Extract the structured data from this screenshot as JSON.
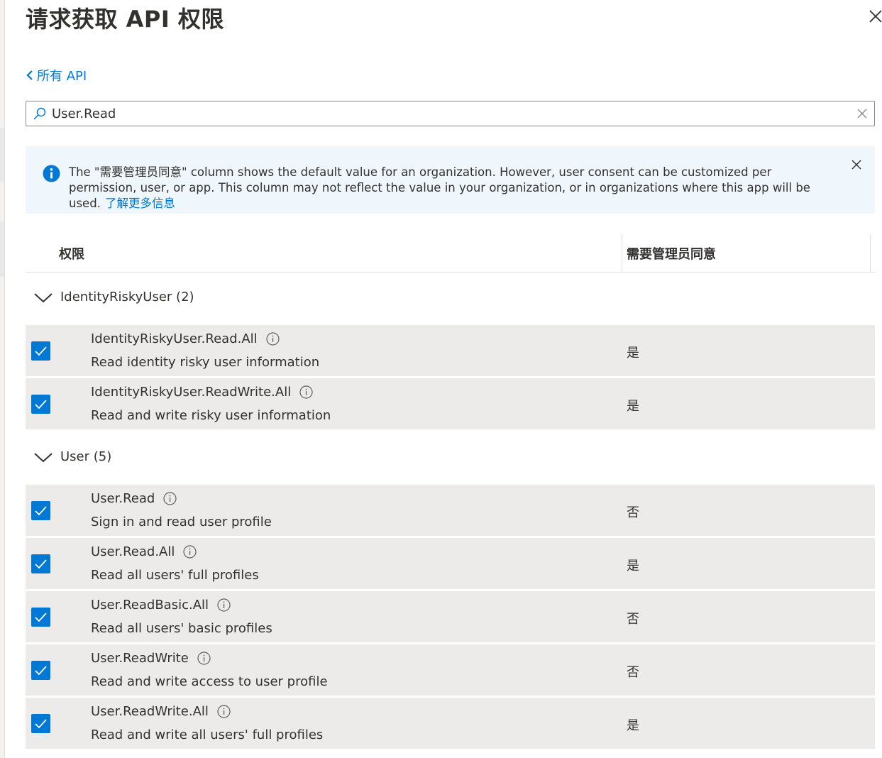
{
  "title": "请求获取 API 权限",
  "back_link": "所有 API",
  "search": {
    "value": "User.Read"
  },
  "info_banner": {
    "message": "The \"需要管理员同意\" column shows the default value for an organization. However, user consent can be customized per permission, user, or app. This column may not reflect the value in your organization, or in organizations where this app will be used.",
    "link": "了解更多信息"
  },
  "table": {
    "col_permission": "权限",
    "col_admin_consent": "需要管理员同意"
  },
  "groups": [
    {
      "label": "IdentityRiskyUser (2)",
      "rows": [
        {
          "name": "IdentityRiskyUser.Read.All",
          "desc": "Read identity risky user information",
          "consent": "是",
          "checked": true
        },
        {
          "name": "IdentityRiskyUser.ReadWrite.All",
          "desc": "Read and write risky user information",
          "consent": "是",
          "checked": true
        }
      ]
    },
    {
      "label": "User (5)",
      "rows": [
        {
          "name": "User.Read",
          "desc": "Sign in and read user profile",
          "consent": "否",
          "checked": true
        },
        {
          "name": "User.Read.All",
          "desc": "Read all users' full profiles",
          "consent": "是",
          "checked": true
        },
        {
          "name": "User.ReadBasic.All",
          "desc": "Read all users' basic profiles",
          "consent": "否",
          "checked": true
        },
        {
          "name": "User.ReadWrite",
          "desc": "Read and write access to user profile",
          "consent": "否",
          "checked": true
        },
        {
          "name": "User.ReadWrite.All",
          "desc": "Read and write all users' full profiles",
          "consent": "是",
          "checked": true
        }
      ]
    }
  ],
  "colors": {
    "accent": "#0078d4",
    "row_bg": "#edebe9",
    "banner_bg": "#eff6fc"
  }
}
